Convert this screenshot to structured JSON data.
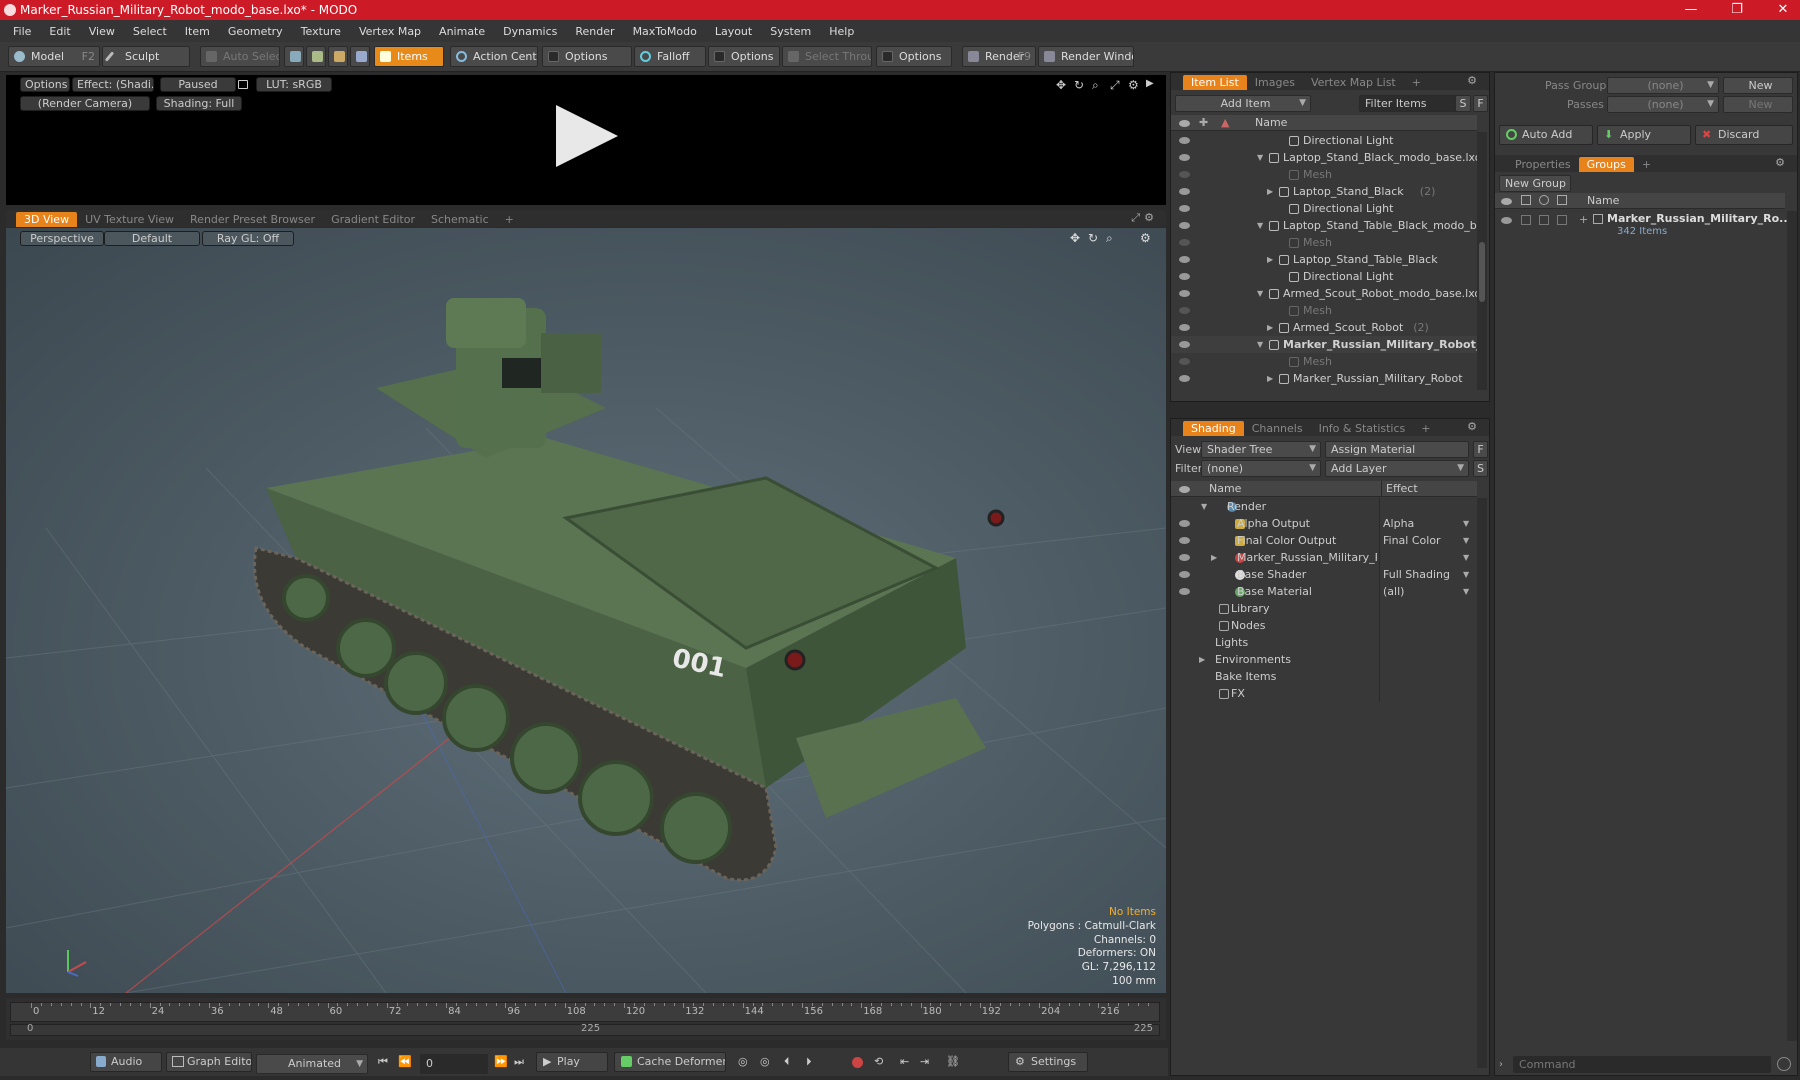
{
  "window": {
    "title": "Marker_Russian_Military_Robot_modo_base.lxo* - MODO",
    "controls": [
      "—",
      "❐",
      "✕"
    ]
  },
  "menu": [
    "File",
    "Edit",
    "View",
    "Select",
    "Item",
    "Geometry",
    "Texture",
    "Vertex Map",
    "Animate",
    "Dynamics",
    "Render",
    "MaxToModo",
    "Layout",
    "System",
    "Help"
  ],
  "toolbar": {
    "model": "Model",
    "model_key": "F2",
    "sculpt": "Sculpt",
    "auto_select": "Auto Select",
    "items": "Items",
    "action_center": "Action Center",
    "options1": "Options",
    "falloff": "Falloff",
    "options2": "Options",
    "select_through": "Select Through",
    "options3": "Options",
    "render": "Render",
    "render_key": "F9",
    "render_window": "Render Window"
  },
  "render_view": {
    "options": "Options",
    "effect": "Effect: (Shadi...",
    "paused": "Paused",
    "lut": "LUT: sRGB",
    "camera": "(Render Camera)",
    "shading": "Shading: Full"
  },
  "viewport_tabs": [
    "3D View",
    "UV Texture View",
    "Render Preset Browser",
    "Gradient Editor",
    "Schematic",
    "+"
  ],
  "viewport": {
    "perspective": "Perspective",
    "default": "Default",
    "raygl": "Ray GL: Off",
    "model_number": "001"
  },
  "stats": {
    "no_items": "No Items",
    "polygons": "Polygons : Catmull-Clark",
    "channels": "Channels: 0",
    "deformers": "Deformers: ON",
    "gl": "GL: 7,296,112",
    "size": "100 mm"
  },
  "timeline": {
    "ticks": [
      "0",
      "12",
      "24",
      "36",
      "48",
      "60",
      "72",
      "84",
      "96",
      "108",
      "120",
      "132",
      "144",
      "156",
      "168",
      "180",
      "192",
      "204",
      "216"
    ],
    "start": "0",
    "mid": "225",
    "end": "225"
  },
  "bottom": {
    "audio": "Audio",
    "graph_editor": "Graph Editor",
    "animated": "Animated",
    "frame": "0",
    "play": "Play",
    "cache": "Cache Deformers",
    "settings": "Settings"
  },
  "item_list": {
    "tabs": [
      "Item List",
      "Images",
      "Vertex Map List",
      "+"
    ],
    "add_item": "Add Item",
    "filter": "Filter Items",
    "s": "S",
    "f": "F",
    "col_name": "Name",
    "rows": [
      {
        "label": "Directional Light",
        "indent": 2,
        "dim": false,
        "bold": false,
        "count": ""
      },
      {
        "label": "Laptop_Stand_Black_modo_base.lxo",
        "indent": 0,
        "dim": false,
        "bold": false,
        "count": ""
      },
      {
        "label": "Mesh",
        "indent": 2,
        "dim": true,
        "bold": false,
        "count": ""
      },
      {
        "label": "Laptop_Stand_Black",
        "indent": 1,
        "dim": false,
        "bold": false,
        "count": "(2)"
      },
      {
        "label": "Directional Light",
        "indent": 2,
        "dim": false,
        "bold": false,
        "count": ""
      },
      {
        "label": "Laptop_Stand_Table_Black_modo_base.lxo",
        "indent": 0,
        "dim": false,
        "bold": false,
        "count": ""
      },
      {
        "label": "Mesh",
        "indent": 2,
        "dim": true,
        "bold": false,
        "count": ""
      },
      {
        "label": "Laptop_Stand_Table_Black",
        "indent": 1,
        "dim": false,
        "bold": false,
        "count": ""
      },
      {
        "label": "Directional Light",
        "indent": 2,
        "dim": false,
        "bold": false,
        "count": ""
      },
      {
        "label": "Armed_Scout_Robot_modo_base.lxo*",
        "indent": 0,
        "dim": false,
        "bold": false,
        "count": ""
      },
      {
        "label": "Mesh",
        "indent": 2,
        "dim": true,
        "bold": false,
        "count": ""
      },
      {
        "label": "Armed_Scout_Robot",
        "indent": 1,
        "dim": false,
        "bold": false,
        "count": "(2)"
      },
      {
        "label": "Marker_Russian_Military_Robot_ ...",
        "indent": 0,
        "dim": false,
        "bold": true,
        "count": ""
      },
      {
        "label": "Mesh",
        "indent": 2,
        "dim": true,
        "bold": false,
        "count": ""
      },
      {
        "label": "Marker_Russian_Military_Robot",
        "indent": 1,
        "dim": false,
        "bold": false,
        "count": "(2)"
      }
    ]
  },
  "shading": {
    "tabs": [
      "Shading",
      "Channels",
      "Info & Statistics",
      "+"
    ],
    "view_label": "View",
    "view_value": "Shader Tree",
    "assign": "Assign Material",
    "f": "F",
    "filter_label": "Filter",
    "filter_value": "(none)",
    "add_layer": "Add Layer",
    "s": "S",
    "col_name": "Name",
    "col_effect": "Effect",
    "rows": [
      {
        "label": "Render",
        "effect": "",
        "indent": 0
      },
      {
        "label": "Alpha Output",
        "effect": "Alpha",
        "indent": 1
      },
      {
        "label": "Final Color Output",
        "effect": "Final Color",
        "indent": 1
      },
      {
        "label": "Marker_Russian_Military_R...",
        "effect": "",
        "indent": 1
      },
      {
        "label": "Base Shader",
        "effect": "Full Shading",
        "indent": 1
      },
      {
        "label": "Base Material",
        "effect": "(all)",
        "indent": 1
      },
      {
        "label": "Library",
        "effect": "",
        "indent": 0
      },
      {
        "label": "Nodes",
        "effect": "",
        "indent": 0
      },
      {
        "label": "Lights",
        "effect": "",
        "indent": 0
      },
      {
        "label": "Environments",
        "effect": "",
        "indent": 0
      },
      {
        "label": "Bake Items",
        "effect": "",
        "indent": 0
      },
      {
        "label": "FX",
        "effect": "",
        "indent": 0
      }
    ]
  },
  "groups": {
    "pass_groups": "Pass Groups",
    "passes": "Passes",
    "none": "(none)",
    "new": "New",
    "auto_add": "Auto Add",
    "apply": "Apply",
    "discard": "Discard",
    "tabs": [
      "Properties",
      "Groups",
      "+"
    ],
    "new_group": "New Group",
    "col_name": "Name",
    "group_name": "Marker_Russian_Military_Ro...",
    "group_count": "342 Items",
    "command": "Command"
  },
  "colors": {
    "accent": "#e8821a",
    "title_bar": "#cc1a26",
    "robot": "#4e6b45"
  }
}
